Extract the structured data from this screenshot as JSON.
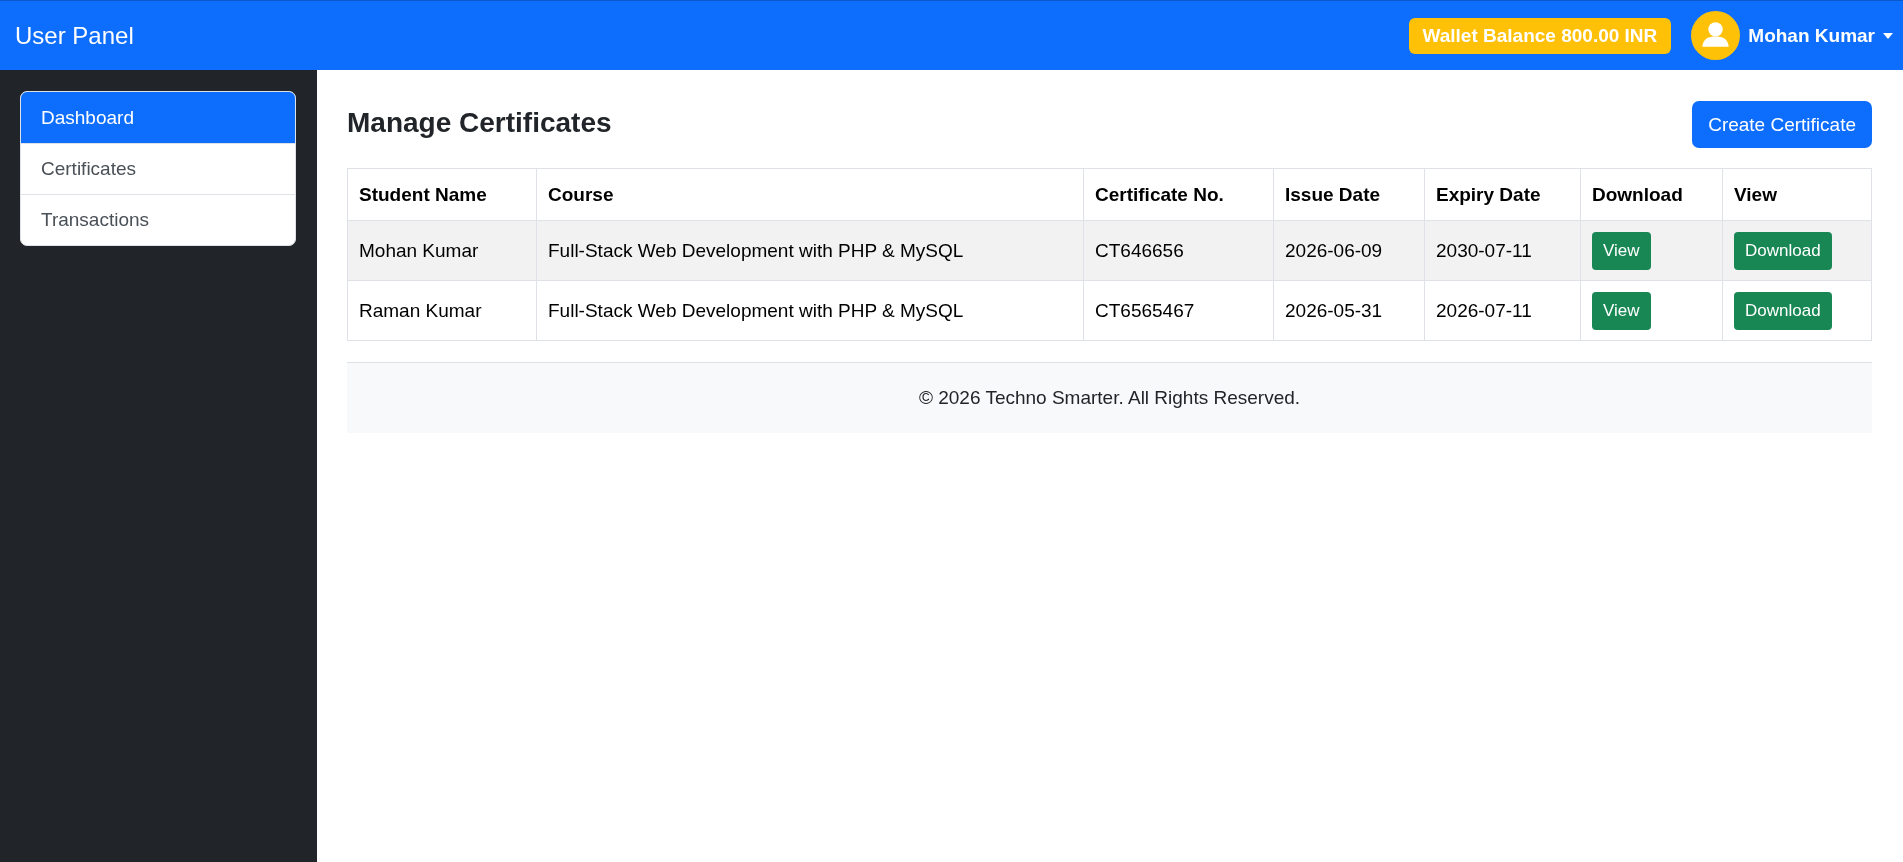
{
  "navbar": {
    "brand": "User Panel",
    "wallet_badge": "Wallet Balance 800.00 INR",
    "user_name": "Mohan Kumar"
  },
  "sidebar": {
    "items": [
      {
        "label": "Dashboard",
        "selected": true
      },
      {
        "label": "Certificates",
        "selected": false
      },
      {
        "label": "Transactions",
        "selected": false
      }
    ]
  },
  "page": {
    "title": "Manage Certificates",
    "create_button": "Create Certificate"
  },
  "table": {
    "columns": [
      "Student Name",
      "Course",
      "Certificate No.",
      "Issue Date",
      "Expiry Date",
      "Download",
      "View"
    ],
    "rows": [
      {
        "cells": [
          "Mohan Kumar",
          "Full-Stack Web Development with PHP & MySQL",
          "CT646656",
          "2026-06-09",
          "2030-07-11"
        ],
        "actions": [
          "View",
          "Download"
        ]
      },
      {
        "cells": [
          "Raman Kumar",
          "Full-Stack Web Development with PHP & MySQL",
          "CT6565467",
          "2026-05-31",
          "2026-07-11"
        ],
        "actions": [
          "View",
          "Download"
        ]
      }
    ]
  },
  "footer": {
    "text": "© 2026 Techno Smarter. All Rights Reserved."
  }
}
